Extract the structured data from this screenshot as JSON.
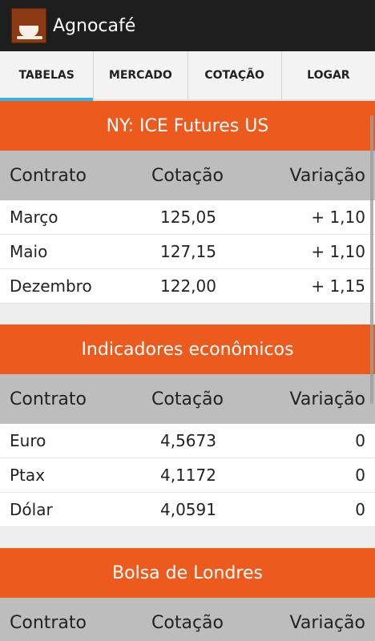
{
  "app": {
    "title": "Agnocafé",
    "logo_icon": "coffee-cup-icon"
  },
  "tabs": [
    {
      "label": "TABELAS",
      "active": true
    },
    {
      "label": "MERCADO",
      "active": false
    },
    {
      "label": "COTAÇÃO",
      "active": false
    },
    {
      "label": "LOGAR",
      "active": false
    }
  ],
  "columns": {
    "c1": "Contrato",
    "c2": "Cotação",
    "c3": "Variação"
  },
  "sections": [
    {
      "title": "NY: ICE Futures US",
      "rows": [
        {
          "contrato": "Março",
          "cotacao": "125,05",
          "variacao": "+ 1,10"
        },
        {
          "contrato": "Maio",
          "cotacao": "127,15",
          "variacao": "+ 1,10"
        },
        {
          "contrato": "Dezembro",
          "cotacao": "122,00",
          "variacao": "+ 1,15"
        }
      ]
    },
    {
      "title": "Indicadores econômicos",
      "rows": [
        {
          "contrato": "Euro",
          "cotacao": "4,5673",
          "variacao": "0"
        },
        {
          "contrato": "Ptax",
          "cotacao": "4,1172",
          "variacao": "0"
        },
        {
          "contrato": "Dólar",
          "cotacao": "4,0591",
          "variacao": "0"
        }
      ]
    },
    {
      "title": "Bolsa de Londres",
      "rows": []
    }
  ],
  "colors": {
    "accent": "#ed5a1d",
    "tab_indicator": "#33b5e5",
    "appbar": "#1e1e1e"
  }
}
